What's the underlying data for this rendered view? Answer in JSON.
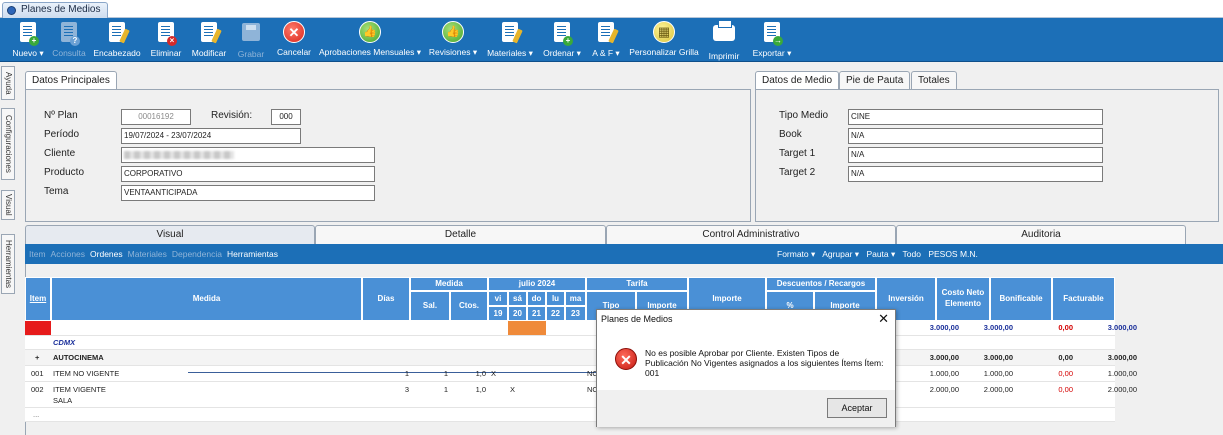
{
  "window": {
    "tab_title": "Planes de Medios"
  },
  "toolbar": [
    {
      "label": "Nuevo ▾",
      "icon": "new-doc-icon",
      "disabled": false
    },
    {
      "label": "Consulta",
      "icon": "query-doc-icon",
      "disabled": true
    },
    {
      "label": "Encabezado",
      "icon": "edit-header-icon",
      "disabled": false
    },
    {
      "label": "Eliminar",
      "icon": "delete-doc-icon",
      "disabled": false
    },
    {
      "label": "Modificar",
      "icon": "edit-doc-icon",
      "disabled": false
    },
    {
      "label": "Grabar",
      "icon": "save-icon",
      "disabled": true
    },
    {
      "label": "Cancelar",
      "icon": "cancel-icon",
      "disabled": false
    },
    {
      "label": "Aprobaciones Mensuales ▾",
      "icon": "thumbs-up-icon",
      "disabled": false
    },
    {
      "label": "Revisiones ▾",
      "icon": "thumbs-up-icon",
      "disabled": false
    },
    {
      "label": "Materiales ▾",
      "icon": "materials-icon",
      "disabled": false
    },
    {
      "label": "Ordenar ▾",
      "icon": "order-icon",
      "disabled": false
    },
    {
      "label": "A & F ▾",
      "icon": "af-icon",
      "disabled": false
    },
    {
      "label": "Personalizar Grilla",
      "icon": "grid-icon",
      "disabled": false
    },
    {
      "label": "Imprimir",
      "icon": "printer-icon",
      "disabled": false
    },
    {
      "label": "Exportar ▾",
      "icon": "export-icon",
      "disabled": false
    }
  ],
  "side_tabs": [
    "Ayuda",
    "Configuraciones",
    "Visual",
    "Herramientas"
  ],
  "principal": {
    "tab": "Datos Principales",
    "plan_label": "Nº Plan",
    "plan_value": "00016192",
    "revision_label": "Revisión:",
    "revision_value": "000",
    "periodo_label": "Período",
    "periodo_value": "19/07/2024 - 23/07/2024",
    "cliente_label": "Cliente",
    "producto_label": "Producto",
    "producto_value": "CORPORATIVO",
    "tema_label": "Tema",
    "tema_value": "VENTAANTICIPADA"
  },
  "medio": {
    "tabs": [
      "Datos de Medio",
      "Pie de Pauta",
      "Totales"
    ],
    "tipo_label": "Tipo Medio",
    "tipo_value": "CINE",
    "book_label": "Book",
    "book_value": "N/A",
    "t1_label": "Target 1",
    "t1_value": "N/A",
    "t2_label": "Target 2",
    "t2_value": "N/A"
  },
  "view_tabs": [
    "Visual",
    "Detalle",
    "Control Administrativo",
    "Auditoria"
  ],
  "subbar": {
    "left": [
      "Item",
      "Acciones",
      "Ordenes",
      "Materiales",
      "Dependencia",
      "Herramientas"
    ],
    "right": [
      "Formato ▾",
      "Agrupar ▾",
      "Pauta ▾",
      "Todo",
      "PESOS M.N."
    ]
  },
  "grid": {
    "headers": {
      "item": "Item",
      "medida": "Medida",
      "dias": "Días",
      "medida_group": "Medida",
      "sal": "Sal.",
      "ctos": "Ctos.",
      "month": "julio 2024",
      "days": [
        "vi",
        "sá",
        "do",
        "lu",
        "ma"
      ],
      "dates": [
        "19",
        "20",
        "21",
        "22",
        "23"
      ],
      "tarifa": "Tarifa",
      "tipo": "Tipo",
      "importe": "Importe",
      "importe_main": "Importe",
      "descuentos": "Descuentos / Recargos",
      "pct": "%",
      "desc_importe": "Importe",
      "inversion": "Inversión",
      "costo_neto": "Costo Neto Elemento",
      "bonificable": "Bonificable",
      "facturable": "Facturable"
    },
    "total_row": {
      "inversion": "3.000,00",
      "costo": "3.000,00",
      "bonificable": "0,00",
      "facturable": "3.000,00"
    },
    "group_label": "CDMX",
    "subgroup": {
      "expander": "+",
      "name": "AUTOCINEMA",
      "inversion": "3.000,00",
      "costo": "3.000,00",
      "bonificable": "0,00",
      "facturable": "3.000,00"
    },
    "rows": [
      {
        "item": "001",
        "medida": "ITEM NO VIGENTE",
        "dias": "1",
        "sal": "1",
        "ctos": "1,0",
        "mark": "X",
        "tipo": "NO",
        "inversion": "1.000,00",
        "costo": "1.000,00",
        "bonificable": "0,00",
        "facturable": "1.000,00"
      },
      {
        "item": "002",
        "medida": "ITEM VIGENTE",
        "medida2": "SALA",
        "dias": "3",
        "sal": "1",
        "ctos": "1,0",
        "mark": "X",
        "tipo": "NO",
        "inversion": "2.000,00",
        "costo": "2.000,00",
        "bonificable": "0,00",
        "facturable": "2.000,00"
      }
    ],
    "more": "..."
  },
  "dialog": {
    "title": "Planes de Medios",
    "message": "No es posible Aprobar por Cliente. Existen Tipos de Publicación No Vigentes asignados a los siguientes Ítems Ítem: 001",
    "button": "Aceptar"
  }
}
